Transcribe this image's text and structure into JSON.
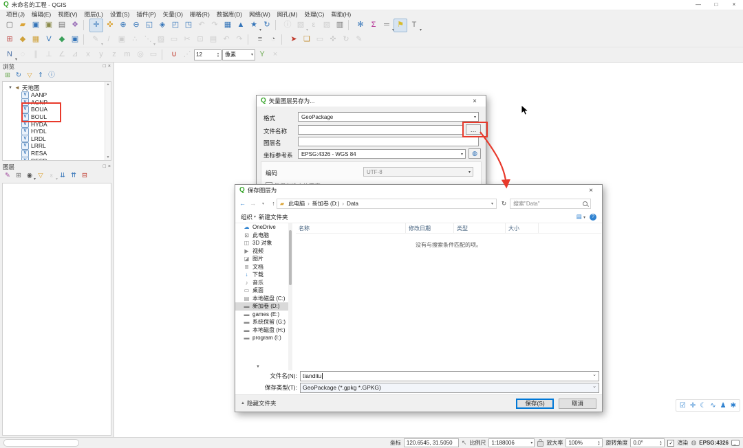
{
  "titlebar": {
    "title": "未命名的工程 - QGIS",
    "minimize": "—",
    "maximize": "□",
    "close": "×"
  },
  "menus": [
    "项目(J)",
    "编辑(E)",
    "视图(V)",
    "图层(L)",
    "设置(S)",
    "插件(P)",
    "矢量(O)",
    "栅格(R)",
    "数据库(D)",
    "网络(W)",
    "网孔(M)",
    "处理(C)",
    "帮助(H)"
  ],
  "toolbars": {
    "row1": [
      {
        "n": "new-project-icon",
        "g": "▢",
        "c": "#6a6a6a"
      },
      {
        "n": "open-project-icon",
        "g": "▰",
        "c": "#dba437"
      },
      {
        "n": "save-project-icon",
        "g": "▣",
        "c": "#3273b8"
      },
      {
        "n": "save-project-as-icon",
        "g": "▣",
        "c": "#8a8a4a"
      },
      {
        "n": "layout-manager-icon",
        "g": "▤",
        "c": "#777777"
      },
      {
        "n": "style-manager-icon",
        "g": "❖",
        "c": "#9a6fb8"
      },
      {
        "sep": true
      },
      {
        "n": "pan-map-icon",
        "g": "✛",
        "c": "#3273b8",
        "s": "pressed"
      },
      {
        "n": "pan-to-selection-icon",
        "g": "✜",
        "c": "#dba437"
      },
      {
        "n": "zoom-in-icon",
        "g": "⊕",
        "c": "#3273b8"
      },
      {
        "n": "zoom-out-icon",
        "g": "⊖",
        "c": "#3273b8"
      },
      {
        "n": "zoom-full-icon",
        "g": "◱",
        "c": "#3273b8"
      },
      {
        "n": "zoom-native-icon",
        "g": "◈",
        "c": "#3273b8"
      },
      {
        "n": "zoom-to-layer-icon",
        "g": "◰",
        "c": "#3273b8"
      },
      {
        "n": "zoom-to-selection-icon",
        "g": "◳",
        "c": "#3273b8"
      },
      {
        "n": "zoom-last-icon",
        "g": "↶",
        "c": "#9a9a9a",
        "s": "disabled"
      },
      {
        "n": "zoom-next-icon",
        "g": "↷",
        "c": "#9a9a9a",
        "s": "disabled"
      },
      {
        "n": "new-map-view-icon",
        "g": "▦",
        "c": "#3273b8"
      },
      {
        "n": "new-3d-map-view-icon",
        "g": "▲",
        "c": "#3273b8"
      },
      {
        "n": "bookmarks-icon",
        "g": "★",
        "c": "#3273b8",
        "s": "dd"
      },
      {
        "n": "refresh-map-icon",
        "g": "↻",
        "c": "#3273b8"
      },
      {
        "sep": true
      },
      {
        "n": "identify-features-icon",
        "g": "ⓘ",
        "c": "#9a9a9a",
        "s": "disabled"
      },
      {
        "n": "select-features-icon",
        "g": "▧",
        "c": "#9a9a9a",
        "s": "disabled dd"
      },
      {
        "n": "select-by-expression-icon",
        "g": "ε",
        "c": "#9a9a9a",
        "s": "disabled"
      },
      {
        "n": "deselect-features-icon",
        "g": "▨",
        "c": "#9a9a9a",
        "s": "disabled"
      },
      {
        "n": "open-attribute-table-icon",
        "g": "▥",
        "c": "#777777"
      },
      {
        "sep": true
      },
      {
        "n": "processing-toolbox-icon",
        "g": "✻",
        "c": "#3273b8"
      },
      {
        "n": "statistics-panel-icon",
        "g": "Σ",
        "c": "#b0278f"
      },
      {
        "n": "measure-icon",
        "g": "═",
        "c": "#777777",
        "s": "dd"
      },
      {
        "n": "map-tips-icon",
        "g": "⚑",
        "c": "#d8bb2b",
        "s": "pressed"
      },
      {
        "n": "text-annotation-icon",
        "g": "T",
        "c": "#777777",
        "s": "dd"
      }
    ],
    "row2": [
      {
        "n": "data-source-manager-icon",
        "g": "⊞",
        "c": "#c0504d"
      },
      {
        "n": "add-vector-layer-icon",
        "g": "◆",
        "c": "#cfa13a"
      },
      {
        "n": "add-raster-layer-icon",
        "g": "▦",
        "c": "#cfa13a"
      },
      {
        "n": "new-shapefile-layer-icon",
        "g": "V",
        "c": "#3273b8"
      },
      {
        "n": "new-geopackage-layer-icon",
        "g": "◆",
        "c": "#3aa05a"
      },
      {
        "n": "new-virtual-layer-icon",
        "g": "▣",
        "c": "#3273b8"
      },
      {
        "sep": true
      },
      {
        "n": "current-edits-icon",
        "g": "✎",
        "c": "#9a9a9a",
        "s": "disabled dd"
      },
      {
        "n": "toggle-editing-icon",
        "g": "/",
        "c": "#9a9a9a",
        "s": "disabled"
      },
      {
        "n": "save-layer-edits-icon",
        "g": "▣",
        "c": "#9a9a9a",
        "s": "disabled"
      },
      {
        "n": "add-feature-icon",
        "g": "∴",
        "c": "#9a9a9a",
        "s": "disabled"
      },
      {
        "n": "vertex-tool-icon",
        "g": "⋱",
        "c": "#9a9a9a",
        "s": "disabled dd"
      },
      {
        "n": "modify-attributes-icon",
        "g": "▨",
        "c": "#9a9a9a",
        "s": "disabled"
      },
      {
        "n": "delete-selected-icon",
        "g": "▭",
        "c": "#9a9a9a",
        "s": "disabled"
      },
      {
        "n": "cut-features-icon",
        "g": "✂",
        "c": "#9a9a9a",
        "s": "disabled"
      },
      {
        "n": "copy-features-icon",
        "g": "⊡",
        "c": "#9a9a9a",
        "s": "disabled"
      },
      {
        "n": "paste-features-icon",
        "g": "▤",
        "c": "#9a9a9a",
        "s": "disabled"
      },
      {
        "n": "undo-icon",
        "g": "↶",
        "c": "#9a9a9a",
        "s": "disabled"
      },
      {
        "n": "redo-icon",
        "g": "↷",
        "c": "#9a9a9a",
        "s": "disabled"
      },
      {
        "sep": true
      },
      {
        "n": "layer-labeling-icon",
        "g": "≡",
        "c": "#7a7a7a"
      },
      {
        "n": "layer-diagram-icon",
        "g": "◔",
        "c": "#7a7a7a"
      },
      {
        "sep": true
      },
      {
        "n": "pin-labels-icon",
        "g": "➤",
        "c": "#c0392b"
      },
      {
        "n": "highlight-labels-icon",
        "g": "❏",
        "c": "#c08a2b"
      },
      {
        "n": "show-hide-labels-icon",
        "g": "▭",
        "c": "#9a9a9a",
        "s": "disabled"
      },
      {
        "n": "move-label-icon",
        "g": "✜",
        "c": "#9a9a9a",
        "s": "disabled"
      },
      {
        "n": "rotate-label-icon",
        "g": "↻",
        "c": "#9a9a9a",
        "s": "disabled"
      },
      {
        "n": "change-label-icon",
        "g": "✎",
        "c": "#9a9a9a",
        "s": "disabled"
      }
    ],
    "row3": [
      {
        "n": "cad-tools-icon",
        "g": "N",
        "c": "#4a6fa5",
        "s": "dd"
      },
      {
        "n": "construction-mode-icon",
        "g": "◌",
        "c": "#9a9a9a",
        "s": "disabled"
      },
      {
        "n": "parallel-tool-icon",
        "g": "∥",
        "c": "#9a9a9a",
        "s": "disabled"
      },
      {
        "n": "perpendicular-tool-icon",
        "g": "⊥",
        "c": "#9a9a9a",
        "s": "disabled"
      },
      {
        "n": "angle-constraint-icon",
        "g": "∠",
        "c": "#9a9a9a",
        "s": "disabled"
      },
      {
        "n": "distance-constraint-icon",
        "g": "⊿",
        "c": "#9a9a9a",
        "s": "disabled"
      },
      {
        "n": "x-constraint-icon",
        "g": "x",
        "c": "#9a9a9a",
        "s": "disabled"
      },
      {
        "n": "y-constraint-icon",
        "g": "y",
        "c": "#9a9a9a",
        "s": "disabled"
      },
      {
        "n": "z-constraint-icon",
        "g": "z",
        "c": "#9a9a9a",
        "s": "disabled"
      },
      {
        "n": "m-constraint-icon",
        "g": "m",
        "c": "#9a9a9a",
        "s": "disabled"
      },
      {
        "n": "snap-common-angles-icon",
        "g": "◎",
        "c": "#9a9a9a",
        "s": "disabled"
      },
      {
        "n": "cad-floater-icon",
        "g": "▭",
        "c": "#9a9a9a",
        "s": "disabled"
      },
      {
        "sep": true
      },
      {
        "n": "snapping-toggle-icon",
        "g": "∪",
        "c": "#c0392b"
      },
      {
        "n": "tracing-offset-icon",
        "g": "⋰",
        "c": "#9a9a9a",
        "s": "disabled"
      }
    ],
    "row3_trail": [
      {
        "n": "topological-editing-icon",
        "g": "Y",
        "c": "#6aa84f"
      },
      {
        "n": "clear-trace-icon",
        "g": "×",
        "c": "#9a9a9a",
        "s": "disabled"
      }
    ],
    "snap_size": "12",
    "snap_unit": "像素"
  },
  "browser": {
    "title": "浏览",
    "tools": [
      {
        "n": "add-selected-layer-icon",
        "g": "⊞",
        "c": "#6aa84f"
      },
      {
        "n": "refresh-browser-icon",
        "g": "↻",
        "c": "#3273b8"
      },
      {
        "n": "filter-browser-icon",
        "g": "▽",
        "c": "#dba437"
      },
      {
        "n": "collapse-all-icon",
        "g": "⇑",
        "c": "#3273b8"
      },
      {
        "n": "properties-widget-icon",
        "g": "ⓘ",
        "c": "#3273b8"
      }
    ],
    "root": "天地图",
    "layer_glyph": "V",
    "items": [
      "AANP",
      "AGNP",
      "BOUA",
      "BOUL",
      "HYDA",
      "HYDL",
      "LRDL",
      "LRRL",
      "RESA",
      "RESP"
    ]
  },
  "layers": {
    "title": "图层",
    "tools": [
      {
        "n": "layer-styling-icon",
        "g": "✎",
        "c": "#a04b9e"
      },
      {
        "n": "add-group-icon",
        "g": "⊞",
        "c": "#777777"
      },
      {
        "n": "manage-themes-icon",
        "g": "◉",
        "c": "#555555",
        "s": "dd"
      },
      {
        "n": "filter-legend-icon",
        "g": "▽",
        "c": "#dba437"
      },
      {
        "n": "filter-by-expression-icon",
        "g": "ε",
        "c": "#9a9a9a",
        "s": "disabled dd"
      },
      {
        "n": "expand-all-icon",
        "g": "⇊",
        "c": "#3273b8"
      },
      {
        "n": "collapse-all-layers-icon",
        "g": "⇈",
        "c": "#3273b8"
      },
      {
        "n": "remove-layer-icon",
        "g": "⊟",
        "c": "#c0392b"
      }
    ]
  },
  "dlg_save_vector": {
    "title": "矢量图层另存为...",
    "format_label": "格式",
    "format_value": "GeoPackage",
    "filename_label": "文件名称",
    "filename_value": "",
    "browse_label": "…",
    "layername_label": "图层名",
    "layername_value": "",
    "crs_label": "坐标参考系",
    "crs_value": "EPSG:4326 - WGS 84",
    "encoding_label": "编码",
    "encoding_value": "UTF-8",
    "only_selected_label": "仅保存选中的要素"
  },
  "dlg_file": {
    "title": "保存图层为",
    "breadcrumb": [
      "此电脑",
      "新加卷 (D:)",
      "Data"
    ],
    "search_placeholder": "搜索\"Data\"",
    "organize_label": "组织",
    "new_folder_label": "新建文件夹",
    "sidebar": [
      {
        "label": "OneDrive",
        "g": "☁",
        "c": "#2f82d0"
      },
      {
        "label": "此电脑",
        "g": "⊡",
        "c": "#555555"
      },
      {
        "label": "3D 对象",
        "g": "◫",
        "c": "#888888"
      },
      {
        "label": "视频",
        "g": "▶",
        "c": "#888888"
      },
      {
        "label": "图片",
        "g": "◪",
        "c": "#888888"
      },
      {
        "label": "文档",
        "g": "≣",
        "c": "#888888"
      },
      {
        "label": "下载",
        "g": "↓",
        "c": "#2f82d0"
      },
      {
        "label": "音乐",
        "g": "♪",
        "c": "#888888"
      },
      {
        "label": "桌面",
        "g": "▭",
        "c": "#888888"
      },
      {
        "label": "本地磁盘 (C:)",
        "g": "▤",
        "c": "#888888"
      },
      {
        "label": "新加卷 (D:)",
        "g": "▬",
        "c": "#888888",
        "s": "selected"
      },
      {
        "label": "games (E:)",
        "g": "▬",
        "c": "#888888"
      },
      {
        "label": "系统保留 (G:)",
        "g": "▬",
        "c": "#888888"
      },
      {
        "label": "本地磁盘 (H:)",
        "g": "▬",
        "c": "#888888"
      },
      {
        "label": "program (I:)",
        "g": "▬",
        "c": "#888888"
      }
    ],
    "columns": [
      "名称",
      "修改日期",
      "类型",
      "大小"
    ],
    "empty_message": "没有与搜索条件匹配的项。",
    "filename_label": "文件名(N):",
    "filename_value": "tianditu",
    "filetype_label": "保存类型(T):",
    "filetype_value": "GeoPackage (*.gpkg *.GPKG)",
    "hide_folders_label": "隐藏文件夹",
    "save_button": "保存(S)",
    "cancel_button": "取消"
  },
  "canvas_tools": [
    {
      "n": "confirm-edit-icon",
      "g": "☑"
    },
    {
      "n": "crosshair-icon",
      "g": "✛"
    },
    {
      "n": "dark-mode-icon",
      "g": "☾"
    },
    {
      "n": "curve-icon",
      "g": "∿"
    },
    {
      "n": "user-icon",
      "g": "♟"
    },
    {
      "n": "settings-icon",
      "g": "✱"
    }
  ],
  "statusbar": {
    "coord_label": "坐标",
    "coord_value": "120.6545, 31.5050",
    "scale_label": "比例尺",
    "scale_value": "1:188006",
    "magnifier_label": "放大率",
    "magnifier_value": "100%",
    "rotation_label": "旋转角度",
    "rotation_value": "0.0°",
    "render_label": "渲染",
    "render_checked": "✓",
    "crs_value": "EPSG:4326"
  }
}
